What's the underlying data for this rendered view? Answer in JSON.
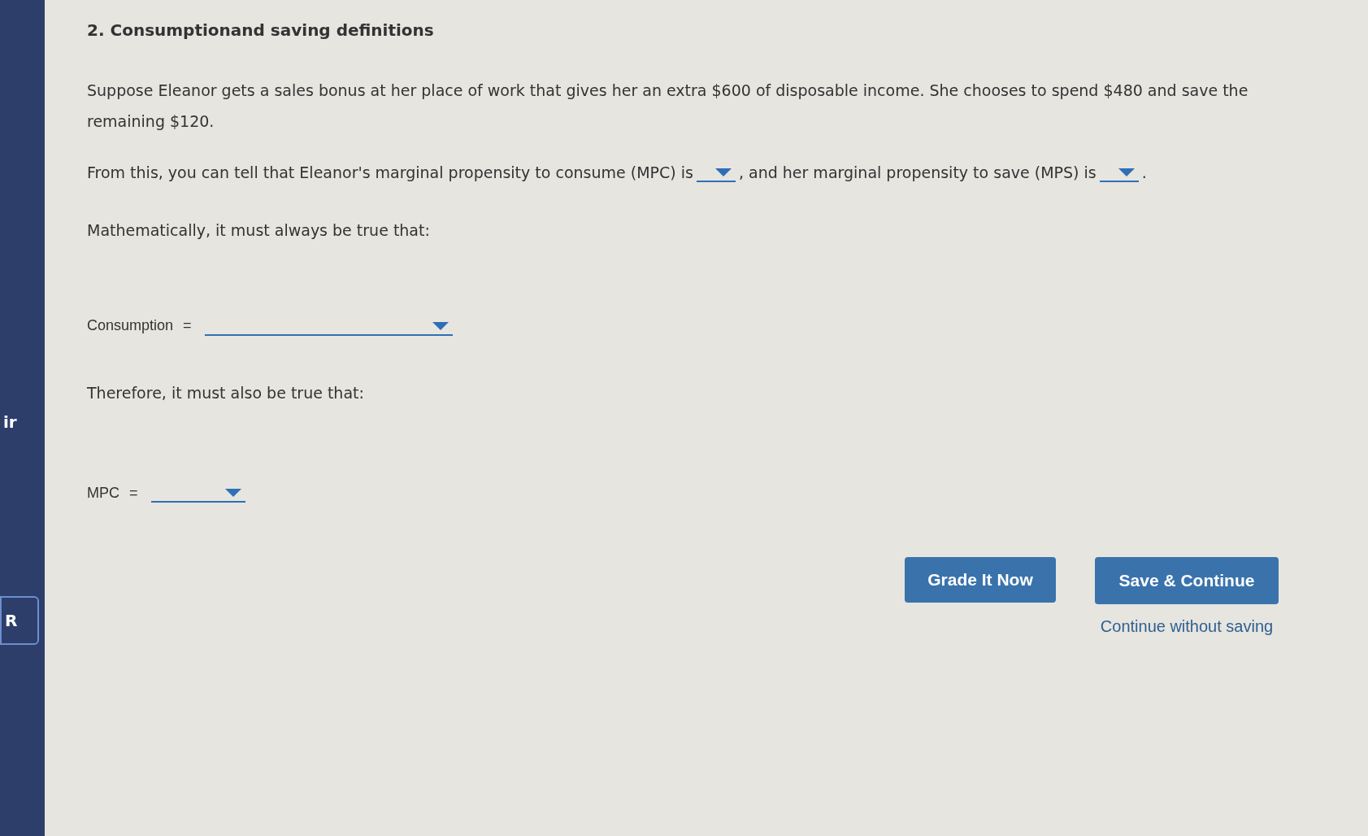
{
  "sidebar": {
    "items": [
      {
        "label": "ir"
      }
    ],
    "button": {
      "label": "R"
    }
  },
  "question": {
    "title": "2. Consumptionand saving definitions",
    "intro": "Suppose Eleanor gets a sales bonus at her place of work that gives her an extra $600 of disposable income. She chooses to spend $480 and save the remaining $120.",
    "sentence": {
      "part_1": "From this, you can tell that Eleanor's marginal propensity to consume (MPC) is",
      "part_2": ", and her marginal propensity to save (MPS) is",
      "part_3": "."
    },
    "prompt_1": "Mathematically, it must always be true that:",
    "equation_1": {
      "label": "Consumption",
      "sign": "="
    },
    "prompt_2": "Therefore, it must also be true that:",
    "equation_2": {
      "label": "MPC",
      "sign": "="
    }
  },
  "actions": {
    "grade": "Grade It Now",
    "save": "Save & Continue",
    "skip": "Continue without saving"
  }
}
